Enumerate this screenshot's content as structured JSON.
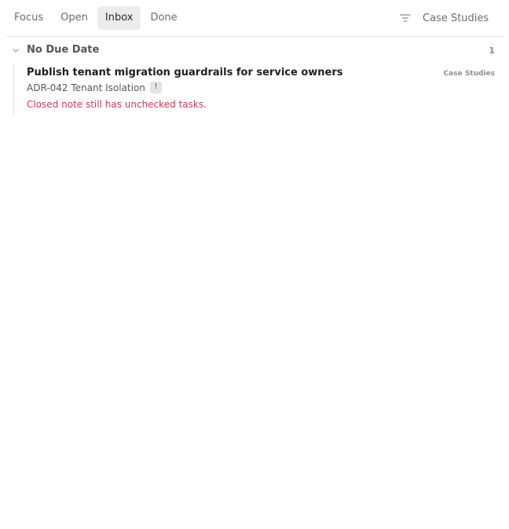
{
  "tabs": [
    {
      "label": "Focus"
    },
    {
      "label": "Open"
    },
    {
      "label": "Inbox"
    },
    {
      "label": "Done"
    }
  ],
  "active_tab": "Inbox",
  "filter": {
    "icon": "filter-icon",
    "label": "Case Studies"
  },
  "group": {
    "icon": "chevron-down-icon",
    "title": "No Due Date",
    "count": "1"
  },
  "item": {
    "title": "Publish tenant migration guardrails for service owners",
    "tag": "Case Studies",
    "ref": "ADR-042 Tenant Isolation",
    "badge": "!",
    "warning": "Closed note still has unchecked tasks."
  },
  "colors": {
    "warning": "#d33a4f",
    "active_tab_bg": "#ececec"
  }
}
